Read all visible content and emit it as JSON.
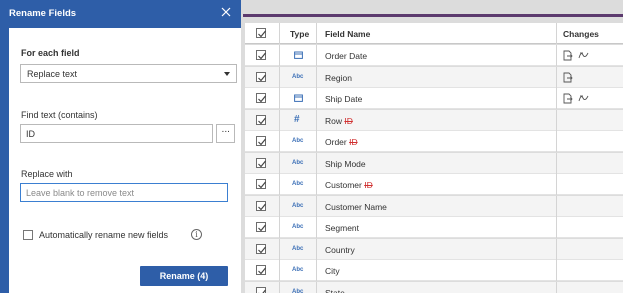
{
  "dialog": {
    "title": "Rename Fields",
    "for_each_field": {
      "label": "For each field",
      "selected": "Replace text"
    },
    "find_text": {
      "label": "Find text (contains)",
      "value": "ID",
      "more_button": "···"
    },
    "replace_with": {
      "label": "Replace with",
      "placeholder": "Leave blank to remove text"
    },
    "auto_rename": {
      "label": "Automatically rename new fields",
      "checked": false,
      "info_icon": "info-icon"
    },
    "rename_button": "Rename (4)"
  },
  "table": {
    "headers": {
      "type": "Type",
      "field_name": "Field Name",
      "changes": "Changes"
    },
    "rows": [
      {
        "type": "date",
        "name_prefix": "Order Date",
        "name_strike": "",
        "changes": [
          "rename-icon",
          "calc-icon"
        ]
      },
      {
        "type": "Abc",
        "name_prefix": "Region",
        "name_strike": "",
        "changes": [
          "rename-icon"
        ]
      },
      {
        "type": "date",
        "name_prefix": "Ship Date",
        "name_strike": "",
        "changes": [
          "rename-icon",
          "calc-icon"
        ]
      },
      {
        "type": "#",
        "name_prefix": "Row ",
        "name_strike": "ID",
        "changes": []
      },
      {
        "type": "Abc",
        "name_prefix": "Order ",
        "name_strike": "ID",
        "changes": []
      },
      {
        "type": "Abc",
        "name_prefix": "Ship Mode",
        "name_strike": "",
        "changes": []
      },
      {
        "type": "Abc",
        "name_prefix": "Customer ",
        "name_strike": "ID",
        "changes": []
      },
      {
        "type": "Abc",
        "name_prefix": "Customer Name",
        "name_strike": "",
        "changes": []
      },
      {
        "type": "Abc",
        "name_prefix": "Segment",
        "name_strike": "",
        "changes": []
      },
      {
        "type": "Abc",
        "name_prefix": "Country",
        "name_strike": "",
        "changes": []
      },
      {
        "type": "Abc",
        "name_prefix": "City",
        "name_strike": "",
        "changes": []
      },
      {
        "type": "Abc",
        "name_prefix": "State",
        "name_strike": "",
        "changes": []
      }
    ]
  },
  "colors": {
    "dialog_blue": "#2e5ea8",
    "type_blue": "#3b6fb6",
    "strike_red": "#d03030",
    "top_bar": "#5c3a6e"
  }
}
